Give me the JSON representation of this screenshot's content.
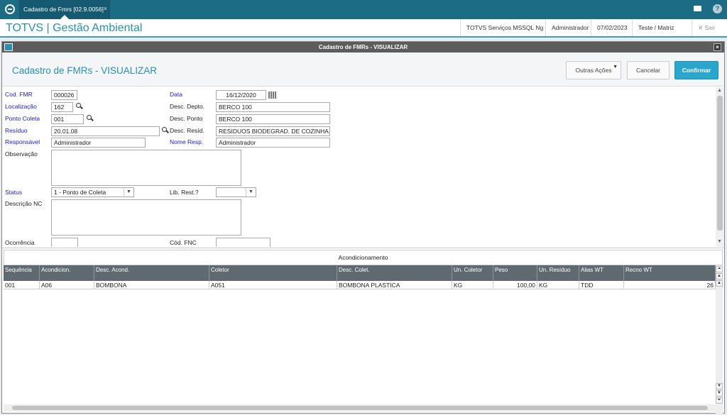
{
  "topbar": {
    "tab_label": "Cadastro de Fmrs [02.9.0056]",
    "tab_close": "×",
    "help": "?"
  },
  "appbar": {
    "title": "TOTVS | Gestão Ambiental",
    "environment": "TOTVS Serviços MSSQL Ng",
    "user": "Administrador",
    "date": "07/02/2023",
    "branch": "Teste / Matriz",
    "exit": "✕ Sair"
  },
  "window": {
    "title": "Cadastro de FMRs - VISUALIZAR",
    "close": "×"
  },
  "header": {
    "title": "Cadastro de FMRs - VISUALIZAR",
    "outras_acoes": "Outras Ações",
    "cancelar": "Cancelar",
    "confirmar": "Confirmar"
  },
  "form": {
    "cod_fmr": {
      "label": "Cod. FMR",
      "value": "000026"
    },
    "data": {
      "label": "Data",
      "value": "16/12/2020"
    },
    "localizacao": {
      "label": "Localização",
      "value": "162"
    },
    "desc_depto": {
      "label": "Desc. Depto.",
      "value": "BERCO 100"
    },
    "ponto_coleta": {
      "label": "Ponto Coleta",
      "value": "001"
    },
    "desc_ponto": {
      "label": "Desc. Ponto",
      "value": "BERCO 100"
    },
    "residuo": {
      "label": "Resíduo",
      "value": "20.01.08"
    },
    "desc_resid": {
      "label": "Desc. Resíd.",
      "value": "RESIDUOS BIODEGRAD. DE COZINHA"
    },
    "responsavel": {
      "label": "Responsável",
      "value": "Administrador"
    },
    "nome_resp": {
      "label": "Nome Resp.",
      "value": "Administrador"
    },
    "observacao": {
      "label": "Observação"
    },
    "status": {
      "label": "Status",
      "value": "1 - Ponto de Coleta"
    },
    "lib_rest": {
      "label": "Lib. Rest.?",
      "value": ""
    },
    "descricao_nc": {
      "label": "Descrição NC"
    },
    "ocorrencia": {
      "label": "Ocorrência",
      "value": ""
    },
    "cod_fnc": {
      "label": "Cód. FNC",
      "value": ""
    }
  },
  "grid": {
    "title": "Acondicionamento",
    "columns": [
      "Sequência",
      "Acondicion.",
      "Desc. Acond.",
      "Coletor",
      "Desc. Colet.",
      "Un. Coletor",
      "Peso",
      "Un. Resíduo",
      "Alias WT",
      "Recno WT"
    ],
    "rows": [
      [
        "001",
        "A06",
        "BOMBONA",
        "A051",
        "BOMBONA PLASTICA",
        "KG",
        "100,00",
        "KG",
        "TDD",
        "26"
      ]
    ]
  }
}
